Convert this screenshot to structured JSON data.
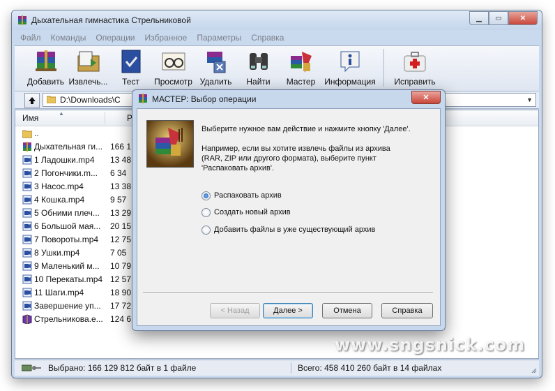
{
  "window": {
    "title": "Дыхательная гимнастика Стрельниковой"
  },
  "menu": [
    "Файл",
    "Команды",
    "Операции",
    "Избранное",
    "Параметры",
    "Справка"
  ],
  "toolbar": [
    {
      "label": "Добавить",
      "icon": "add-archive-icon"
    },
    {
      "label": "Извлечь...",
      "icon": "extract-icon"
    },
    {
      "label": "Тест",
      "icon": "test-icon"
    },
    {
      "label": "Просмотр",
      "icon": "view-icon"
    },
    {
      "label": "Удалить",
      "icon": "delete-icon"
    },
    {
      "label": "Найти",
      "icon": "find-icon"
    },
    {
      "label": "Мастер",
      "icon": "wizard-icon"
    },
    {
      "label": "Информация",
      "icon": "info-icon"
    },
    {
      "label": "Исправить",
      "icon": "repair-icon"
    }
  ],
  "address": {
    "path": "D:\\Downloads\\С"
  },
  "columns": {
    "name": "Имя",
    "size": "Р"
  },
  "files": [
    {
      "name": "..",
      "size": "",
      "icon": "folder-up-icon"
    },
    {
      "name": "Дыхательная ги...",
      "size": "166 1",
      "icon": "rar-archive-icon"
    },
    {
      "name": "1 Ладошки.mp4",
      "size": "13 48",
      "icon": "video-file-icon"
    },
    {
      "name": "2 Погончики.m...",
      "size": "6 34",
      "icon": "video-file-icon"
    },
    {
      "name": "3 Насос.mp4",
      "size": "13 38",
      "icon": "video-file-icon"
    },
    {
      "name": "4 Кошка.mp4",
      "size": "9 57",
      "icon": "video-file-icon"
    },
    {
      "name": "5 Обними плеч...",
      "size": "13 29",
      "icon": "video-file-icon"
    },
    {
      "name": "6 Большой мая...",
      "size": "20 15",
      "icon": "video-file-icon"
    },
    {
      "name": "7 Повороты.mp4",
      "size": "12 75",
      "icon": "video-file-icon"
    },
    {
      "name": "8 Ушки.mp4",
      "size": "7 05",
      "icon": "video-file-icon"
    },
    {
      "name": "9 Маленький м...",
      "size": "10 79",
      "icon": "video-file-icon"
    },
    {
      "name": "10 Перекаты.mp4",
      "size": "12 57",
      "icon": "video-file-icon"
    },
    {
      "name": "11 Шаги.mp4",
      "size": "18 90",
      "icon": "video-file-icon"
    },
    {
      "name": "Завершение уп...",
      "size": "17 72",
      "icon": "video-file-icon"
    },
    {
      "name": "Стрельникова.е...",
      "size": "124 6",
      "icon": "ebook-file-icon"
    }
  ],
  "status": {
    "left": "Выбрано: 166 129 812 байт в 1 файле",
    "right": "Всего: 458 410 260 байт в 14 файлах"
  },
  "dialog": {
    "title": "МАСТЕР:   Выбор операции",
    "close": "✕",
    "instruction": "Выберите нужное вам действие и нажмите кнопку 'Далее'.",
    "hint": "Например, если вы хотите извлечь файлы из архива (RAR, ZIP или другого формата), выберите пункт 'Распаковать архив'.",
    "options": [
      {
        "label": "Распаковать архив",
        "selected": true
      },
      {
        "label": "Создать новый архив",
        "selected": false
      },
      {
        "label": "Добавить файлы в уже существующий архив",
        "selected": false
      }
    ],
    "buttons": {
      "back": "< Назад",
      "next": "Далее >",
      "cancel": "Отмена",
      "help": "Справка"
    }
  },
  "watermark": "www.sngsnick.com"
}
